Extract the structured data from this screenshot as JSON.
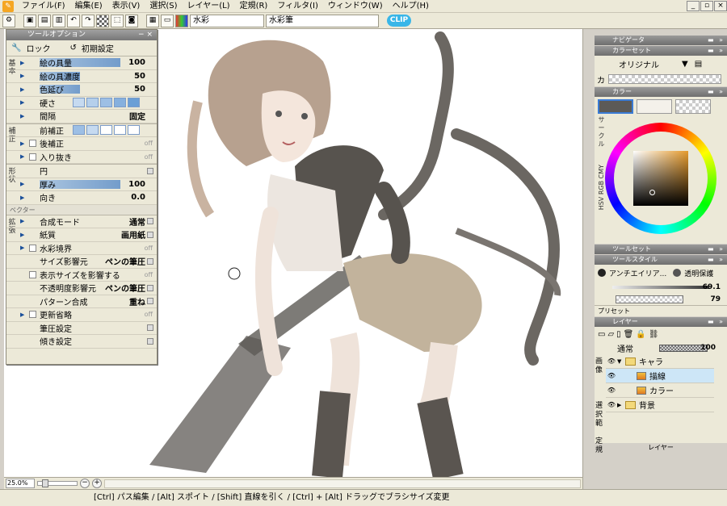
{
  "menu": [
    "ファイル(F)",
    "編集(E)",
    "表示(V)",
    "選択(S)",
    "レイヤー(L)",
    "定規(R)",
    "フィルタ(I)",
    "ウィンドウ(W)",
    "ヘルプ(H)"
  ],
  "window_controls": {
    "minimize": "_",
    "restore": "▫",
    "close": "×"
  },
  "toolbar": {
    "preset_field": "水彩",
    "brush_field": "水彩筆",
    "badge": "CLIP"
  },
  "tool_options": {
    "title": "ツールオプション",
    "lock_label": "ロック",
    "reset_label": "初期設定",
    "categories": {
      "basic": "基本",
      "correction": "補正",
      "shape": "形状",
      "extend": "拡張"
    },
    "basic_rows": [
      {
        "label": "絵の具量",
        "value": "100",
        "fill": 1.0
      },
      {
        "label": "絵の具濃度",
        "value": "50",
        "fill": 0.5
      },
      {
        "label": "色延び",
        "value": "50",
        "fill": 0.5
      }
    ],
    "hardness_label": "硬さ",
    "interval_label": "間隔",
    "interval_value": "固定",
    "pre_correction_label": "前補正",
    "post_correction_label": "後補正",
    "post_correction_value": "off",
    "taper_label": "入り抜き",
    "taper_value": "off",
    "shape_circle_label": "円",
    "thickness_label": "厚み",
    "thickness_value": "100",
    "thickness_fill": 1.0,
    "direction_label": "向き",
    "direction_value": "0.0",
    "vector_section": "ベクター",
    "extend_rows": [
      {
        "label": "合成モード",
        "value": "通常",
        "check": false,
        "arrow": true
      },
      {
        "label": "紙質",
        "value": "画用紙",
        "check": false,
        "arrow": true
      },
      {
        "label": "水彩境界",
        "value": "off",
        "check": true,
        "arrow": true,
        "off": true
      },
      {
        "label": "サイズ影響元",
        "value": "ペンの筆圧",
        "check": false,
        "arrow": false
      },
      {
        "label": "表示サイズを影響する",
        "value": "off",
        "check": true,
        "arrow": false,
        "off": true
      },
      {
        "label": "不透明度影響元",
        "value": "ペンの筆圧",
        "check": false,
        "arrow": false
      },
      {
        "label": "パターン合成",
        "value": "重ね",
        "check": false,
        "arrow": false
      },
      {
        "label": "更新省略",
        "value": "off",
        "check": true,
        "arrow": true,
        "off": true
      },
      {
        "label": "筆圧設定",
        "value": "",
        "check": false,
        "arrow": false
      },
      {
        "label": "傾き設定",
        "value": "",
        "check": false,
        "arrow": false
      }
    ]
  },
  "right_panel": {
    "navigator_title": "ナビゲータ",
    "colorset_title": "カラーセット",
    "colorset_name": "オリジナル",
    "colorset_prefix": "カ",
    "color_title": "カラー",
    "color_tabs": "サークル",
    "color_tabs2": "HSV RGB CMY",
    "toolset_title": "ツールセット",
    "toolstyle_title": "ツールスタイル",
    "antialias_label": "アンチエイリア...",
    "transparency_label": "透明保護",
    "size_value": "69.1",
    "opacity_value": "79",
    "preset_label": "プリセット",
    "layer_title": "レイヤー",
    "blend_mode": "通常",
    "layer_opacity": "100",
    "layer_tabs": "画像",
    "layer_tabs2": "選択範",
    "layer_tabs3": "定規",
    "layers": [
      {
        "name": "キャラ",
        "type": "folder",
        "indent": 0,
        "open": true
      },
      {
        "name": "描線",
        "type": "layer",
        "indent": 1,
        "selected": true
      },
      {
        "name": "カラー",
        "type": "layer",
        "indent": 1
      },
      {
        "name": "背景",
        "type": "folder",
        "indent": 0,
        "open": false
      }
    ],
    "bottom_tab": "レイヤー"
  },
  "zoom": "25.0%",
  "status": "[Ctrl] パス編集 / [Alt] スポイト / [Shift] 直線を引く / [Ctrl] + [Alt] ドラッグでブラシサイズ変更",
  "colors": {
    "accent": "#3f7bc5",
    "selected_layer": "#cde6f7",
    "badge": "#39b6e8"
  }
}
